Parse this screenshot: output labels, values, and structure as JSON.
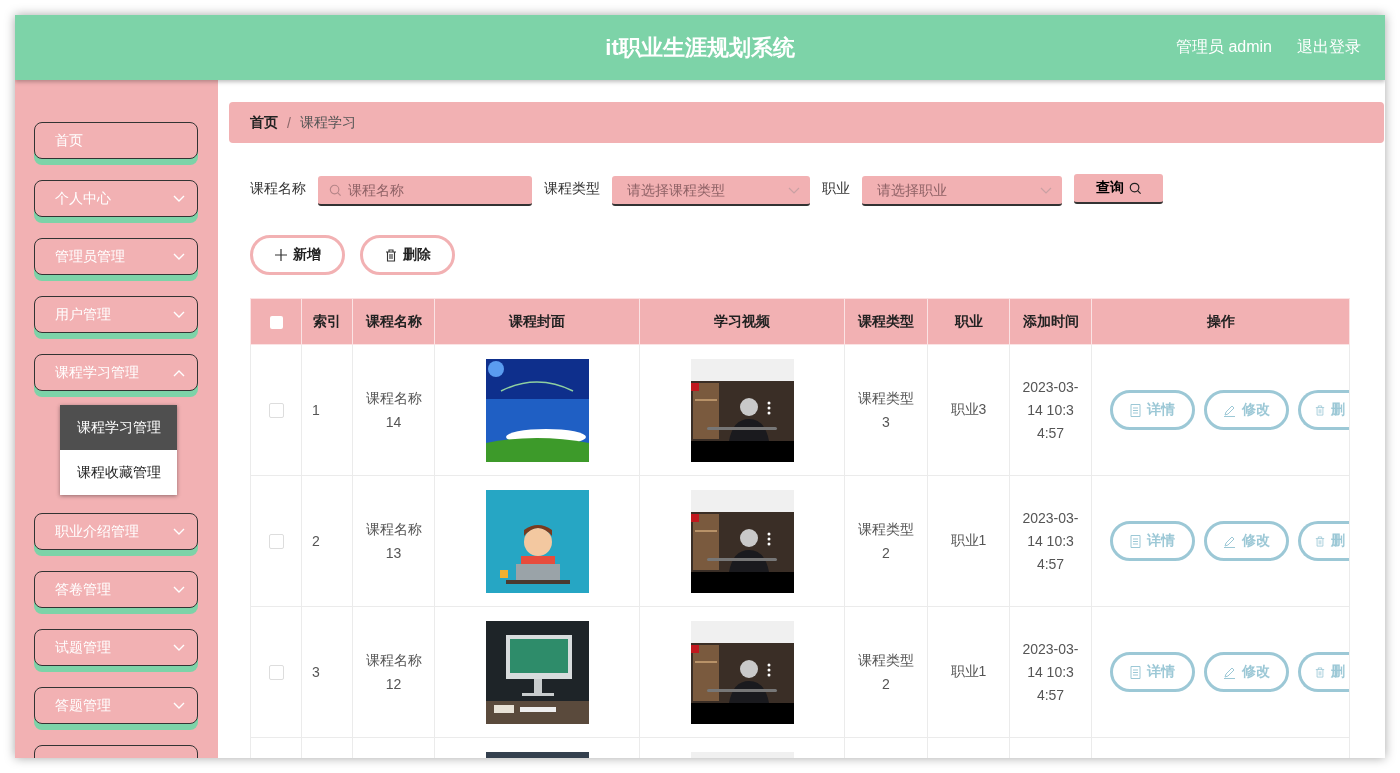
{
  "header": {
    "title": "it职业生涯规划系统",
    "user": "管理员 admin",
    "logout": "退出登录"
  },
  "sidebar": {
    "items": [
      {
        "label": "首页",
        "expandable": false
      },
      {
        "label": "个人中心",
        "expandable": true,
        "expanded": false
      },
      {
        "label": "管理员管理",
        "expandable": true,
        "expanded": false
      },
      {
        "label": "用户管理",
        "expandable": true,
        "expanded": false
      },
      {
        "label": "课程学习管理",
        "expandable": true,
        "expanded": true,
        "children": [
          {
            "label": "课程学习管理",
            "selected": true
          },
          {
            "label": "课程收藏管理",
            "selected": false
          }
        ]
      },
      {
        "label": "职业介绍管理",
        "expandable": true,
        "expanded": false
      },
      {
        "label": "答卷管理",
        "expandable": true,
        "expanded": false
      },
      {
        "label": "试题管理",
        "expandable": true,
        "expanded": false
      },
      {
        "label": "答题管理",
        "expandable": true,
        "expanded": false
      },
      {
        "expandable": false
      }
    ]
  },
  "breadcrumb_separator": "/",
  "breadcrumb": [
    {
      "label": "首页",
      "current": false
    },
    {
      "label": "课程学习",
      "current": true
    }
  ],
  "filters": [
    {
      "label": "课程名称",
      "kind": "search",
      "placeholder": "课程名称"
    },
    {
      "label": "课程类型",
      "kind": "select",
      "placeholder": "请选择课程类型"
    },
    {
      "label": "职业",
      "kind": "select",
      "placeholder": "请选择职业"
    }
  ],
  "search_button": "查询",
  "actions": [
    {
      "label": "新增",
      "kind": "add"
    },
    {
      "label": "删除",
      "kind": "delete"
    }
  ],
  "table": {
    "select_all": false,
    "columns": [
      "索引",
      "课程名称",
      "课程封面",
      "学习视频",
      "课程类型",
      "职业",
      "添加时间",
      "操作"
    ],
    "rows": [
      {
        "checked": false,
        "index": "1",
        "name": "课程名称14",
        "cover": {
          "kind": "picture"
        },
        "video": {
          "kind": "picture"
        },
        "type": "课程类型3",
        "job": "职业3",
        "time": "2023-03-14 10:34:57",
        "actions": [
          {
            "label": "详情",
            "kind": "detail"
          },
          {
            "label": "修改",
            "kind": "edit"
          },
          {
            "label": "删",
            "kind": "delete"
          }
        ]
      },
      {
        "checked": false,
        "index": "2",
        "name": "课程名称13",
        "cover": {
          "kind": "picture"
        },
        "video": {
          "kind": "picture"
        },
        "type": "课程类型2",
        "job": "职业1",
        "time": "2023-03-14 10:34:57",
        "actions": [
          {
            "label": "详情",
            "kind": "detail"
          },
          {
            "label": "修改",
            "kind": "edit"
          },
          {
            "label": "删",
            "kind": "delete"
          }
        ]
      },
      {
        "checked": false,
        "index": "3",
        "name": "课程名称12",
        "cover": {
          "kind": "picture"
        },
        "video": {
          "kind": "picture"
        },
        "type": "课程类型2",
        "job": "职业1",
        "time": "2023-03-14 10:34:57",
        "actions": [
          {
            "label": "详情",
            "kind": "detail"
          },
          {
            "label": "修改",
            "kind": "edit"
          },
          {
            "label": "删",
            "kind": "delete"
          }
        ]
      },
      {
        "cover": {
          "kind": "picture"
        },
        "video": {
          "kind": "picture"
        }
      }
    ]
  }
}
